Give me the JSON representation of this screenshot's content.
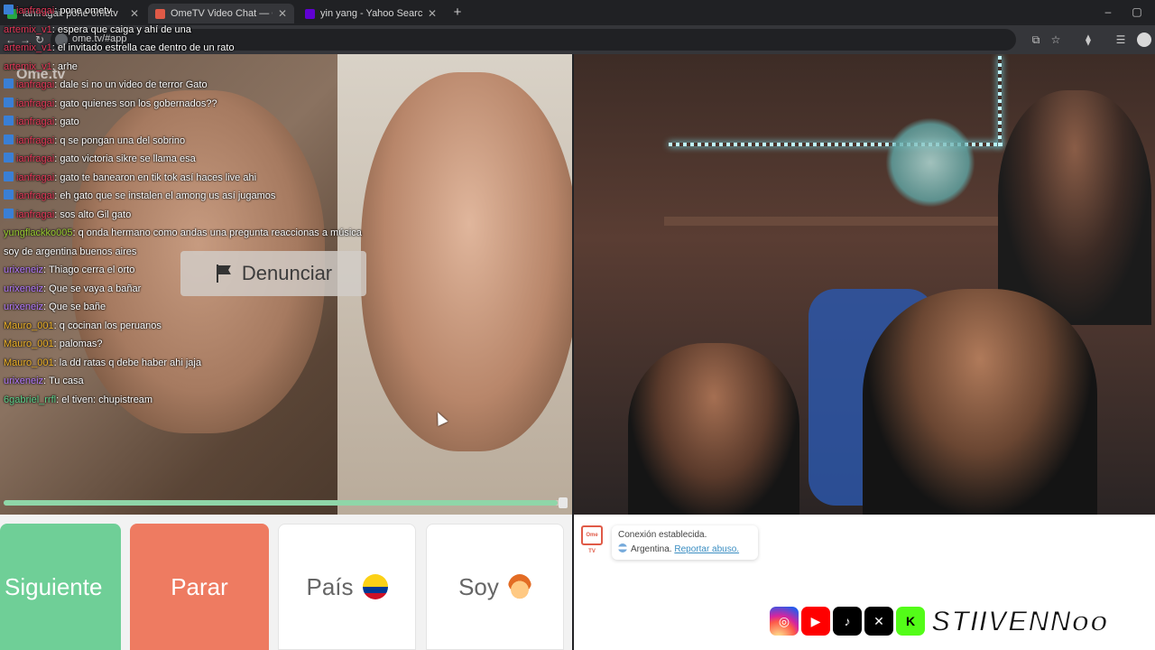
{
  "browser": {
    "tabs": [
      {
        "title": "ianfragai: pone ometv",
        "active": false
      },
      {
        "title": "OmeTV Video Chat — Ome",
        "active": true
      },
      {
        "title": "yin yang - Yahoo Search Tus re",
        "active": false
      }
    ],
    "new_tab": "+",
    "minimize": "–",
    "maximize": "▢",
    "url": "ome.tv/#app"
  },
  "video": {
    "brand": "Ome.tv",
    "report_label": "Denunciar",
    "progress": 0.99
  },
  "chat": [
    {
      "user": "ianfragai",
      "text": ": pone ometv",
      "user_color": "#e5395a",
      "icon": true
    },
    {
      "user": "artemix_v1",
      "text": ": espera que caiga y ahí de una",
      "user_color": "#e5395a",
      "icon": false
    },
    {
      "user": "artemix_v1",
      "text": ": el invitado estrella cae dentro de un rato",
      "user_color": "#e5395a",
      "icon": false
    },
    {
      "user": "artemix_v1",
      "text": ": arhe",
      "user_color": "#e5395a",
      "icon": false
    },
    {
      "user": "ianfragai",
      "text": ": dale si no un video de terror Gato",
      "user_color": "#e5395a",
      "icon": true
    },
    {
      "user": "ianfragai",
      "text": ": gato quienes son los gobernados??",
      "user_color": "#e5395a",
      "icon": true
    },
    {
      "user": "ianfragai",
      "text": ": gato",
      "user_color": "#e5395a",
      "icon": true
    },
    {
      "user": "ianfragai",
      "text": ": q se pongan una del sobrino",
      "user_color": "#e5395a",
      "icon": true
    },
    {
      "user": "ianfragai",
      "text": ": gato victoria sikre se llama esa",
      "user_color": "#e5395a",
      "icon": true
    },
    {
      "user": "ianfragai",
      "text": ": gato te banearon en tik tok así haces live ahi",
      "user_color": "#e5395a",
      "icon": true
    },
    {
      "user": "ianfragai",
      "text": ": eh gato que se instalen el among us así jugamos",
      "user_color": "#e5395a",
      "icon": true
    },
    {
      "user": "ianfragai",
      "text": ": sos alto Gil gato",
      "user_color": "#e5395a",
      "icon": true
    },
    {
      "user": "yungflackko005",
      "text": ": q onda hermano como andas una pregunta reaccionas a música",
      "user_color": "#9acd32",
      "icon": false
    },
    {
      "user": "",
      "text": "soy de argentina buenos aires",
      "user_color": "#9acd32",
      "icon": false
    },
    {
      "user": "urixeneiz",
      "text": ": Thiago cerra el orto",
      "user_color": "#b57bff",
      "icon": false
    },
    {
      "user": "urixeneiz",
      "text": ": Que se vaya a bañar",
      "user_color": "#b57bff",
      "icon": false
    },
    {
      "user": "urixeneiz",
      "text": ": Que se bañe",
      "user_color": "#b57bff",
      "icon": false
    },
    {
      "user": "Mauro_001",
      "text": ": q cocinan los peruanos",
      "user_color": "#f0b429",
      "icon": false
    },
    {
      "user": "Mauro_001",
      "text": ": palomas?",
      "user_color": "#f0b429",
      "icon": false
    },
    {
      "user": "Mauro_001",
      "text": ": la dd ratas q debe haber ahi jaja",
      "user_color": "#f0b429",
      "icon": false
    },
    {
      "user": "urixeneiz",
      "text": ": Tu casa",
      "user_color": "#b57bff",
      "icon": false
    },
    {
      "user": "6gabriel_rrfl",
      "text": ": el tiven: chupistream",
      "user_color": "#5fd38d",
      "icon": false
    }
  ],
  "controls": {
    "next": "Siguiente",
    "stop": "Parar",
    "country": "País",
    "gender": "Soy"
  },
  "textchat": {
    "icon_label": "Ome TV",
    "connected": "Conexión establecida.",
    "country": "Argentina.",
    "report_abuse": "Reportar abuso."
  },
  "social": {
    "icons": [
      "instagram-icon",
      "youtube-icon",
      "tiktok-icon",
      "x-icon",
      "kick-icon"
    ],
    "handle": "STIIVENNoo"
  }
}
